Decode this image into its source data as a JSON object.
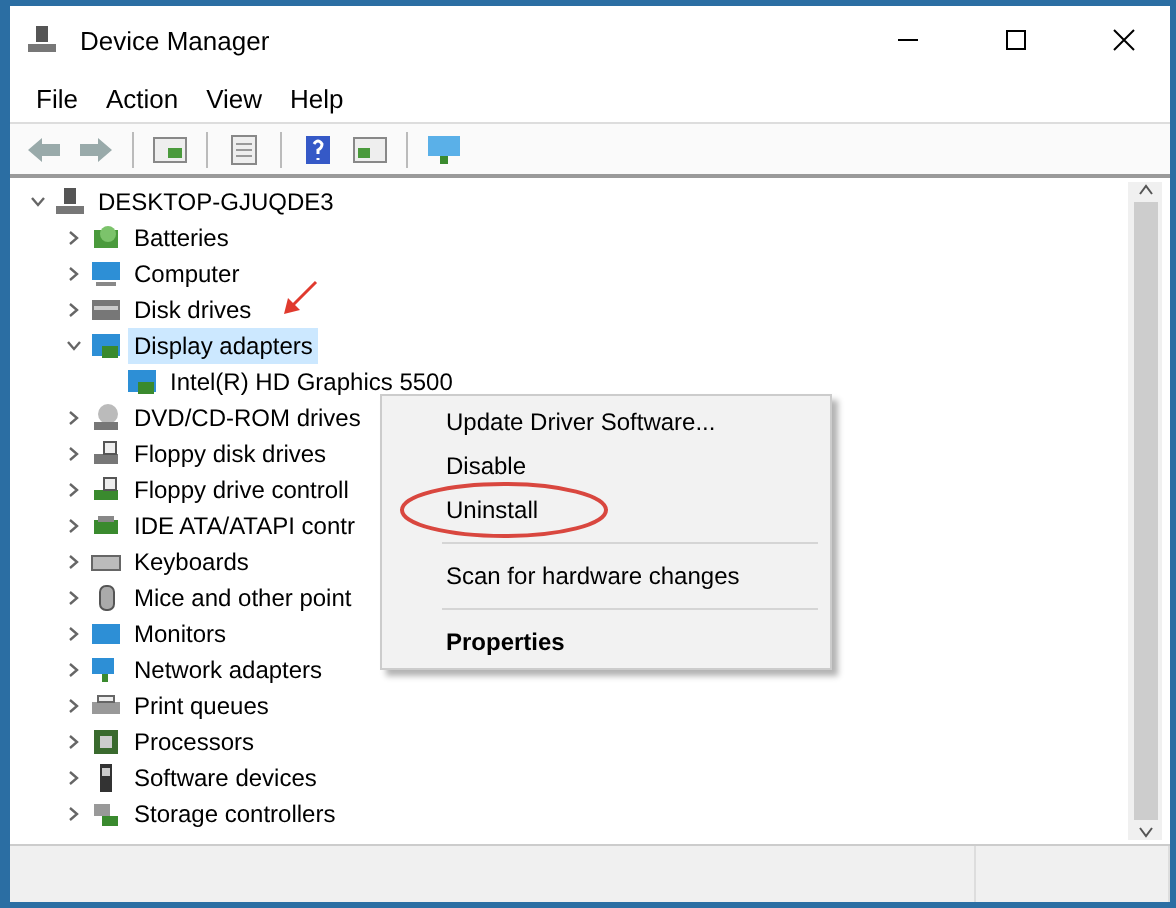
{
  "window": {
    "title": "Device Manager"
  },
  "menu": [
    "File",
    "Action",
    "View",
    "Help"
  ],
  "tree": {
    "label": "DESKTOP-GJUQDE3",
    "expanded": true,
    "selected": false,
    "children": [
      {
        "label": "Batteries",
        "expanded": false,
        "selected": false
      },
      {
        "label": "Computer",
        "expanded": false,
        "selected": false
      },
      {
        "label": "Disk drives",
        "expanded": false,
        "selected": false
      },
      {
        "label": "Display adapters",
        "expanded": true,
        "selected": true,
        "children": [
          {
            "label": "Intel(R) HD Graphics 5500",
            "selected": false
          }
        ]
      },
      {
        "label": "DVD/CD-ROM drives",
        "expanded": false,
        "selected": false
      },
      {
        "label": "Floppy disk drives",
        "expanded": false,
        "selected": false
      },
      {
        "label": "Floppy drive controll",
        "expanded": false,
        "selected": false
      },
      {
        "label": "IDE ATA/ATAPI contr",
        "expanded": false,
        "selected": false
      },
      {
        "label": "Keyboards",
        "expanded": false,
        "selected": false
      },
      {
        "label": "Mice and other point",
        "expanded": false,
        "selected": false
      },
      {
        "label": "Monitors",
        "expanded": false,
        "selected": false
      },
      {
        "label": "Network adapters",
        "expanded": false,
        "selected": false
      },
      {
        "label": "Print queues",
        "expanded": false,
        "selected": false
      },
      {
        "label": "Processors",
        "expanded": false,
        "selected": false
      },
      {
        "label": "Software devices",
        "expanded": false,
        "selected": false
      },
      {
        "label": "Storage controllers",
        "expanded": false,
        "selected": false
      }
    ]
  },
  "context_menu": {
    "items": [
      {
        "kind": "item",
        "label": "Update Driver Software...",
        "default": false,
        "circled": false
      },
      {
        "kind": "item",
        "label": "Disable",
        "default": false,
        "circled": false
      },
      {
        "kind": "item",
        "label": "Uninstall",
        "default": false,
        "circled": true
      },
      {
        "kind": "separator"
      },
      {
        "kind": "item",
        "label": "Scan for hardware changes",
        "default": false,
        "circled": false
      },
      {
        "kind": "separator"
      },
      {
        "kind": "item",
        "label": "Properties",
        "default": true,
        "circled": false
      }
    ]
  }
}
